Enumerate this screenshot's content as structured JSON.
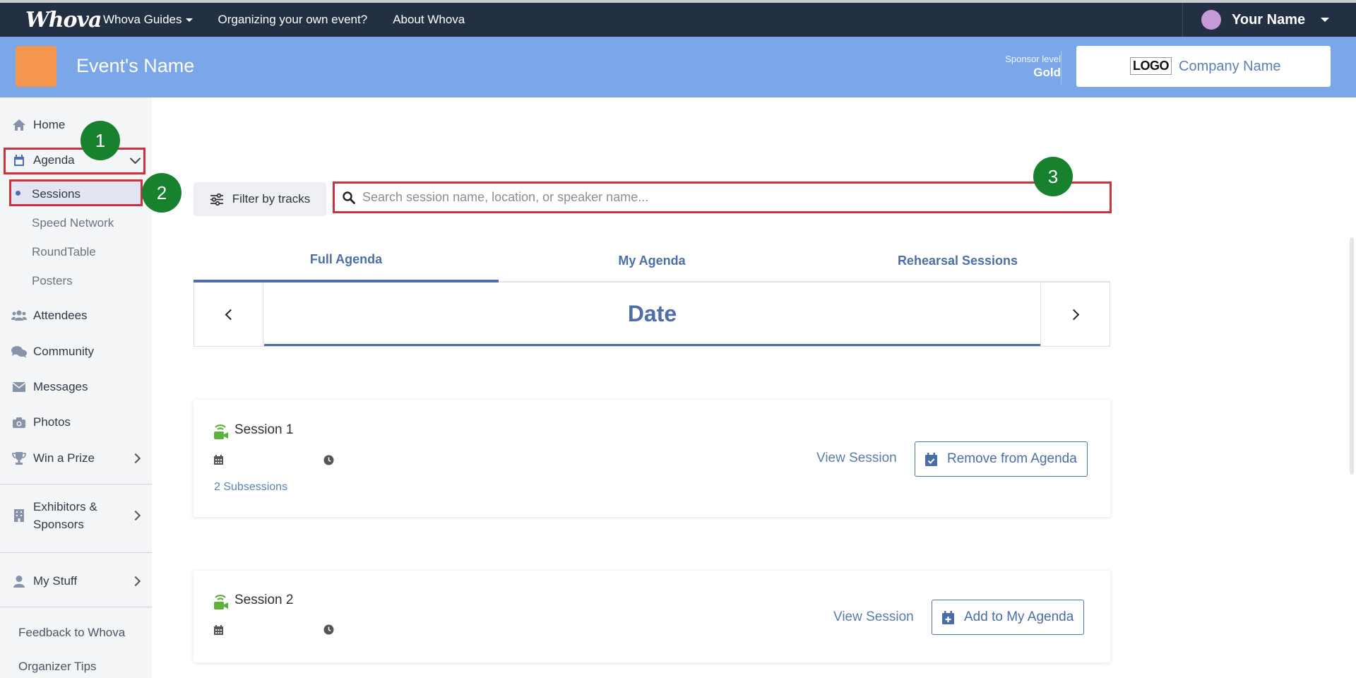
{
  "topnav": {
    "brand": "Whova",
    "links": [
      "Whova Guides",
      "Organizing your own event?",
      "About Whova"
    ],
    "user_name": "Your Name"
  },
  "banner": {
    "event_name": "Event's Name",
    "sponsor_level_label": "Sponsor level",
    "sponsor_level_value": "Gold",
    "logo_text": "LOGO",
    "company_name": "Company Name",
    "colors": {
      "banner": "#7ba7e8",
      "event_logo": "#f4964e",
      "topnav": "#233043"
    }
  },
  "sidebar": {
    "home": "Home",
    "agenda": "Agenda",
    "agenda_sub": [
      "Sessions",
      "Speed Network",
      "RoundTable",
      "Posters"
    ],
    "attendees": "Attendees",
    "community": "Community",
    "messages": "Messages",
    "photos": "Photos",
    "win_prize": "Win a Prize",
    "exhibitors_line1": "Exhibitors &",
    "exhibitors_line2": "Sponsors",
    "my_stuff": "My Stuff",
    "feedback": "Feedback to Whova",
    "organizer_tips": "Organizer Tips"
  },
  "annotations": {
    "badges": [
      "1",
      "2",
      "3"
    ],
    "highlight_color": "#d32f3b",
    "badge_color": "#17812e"
  },
  "main": {
    "filter_label": "Filter by tracks",
    "search_placeholder": "Search session name, location, or speaker name...",
    "tabs": [
      "Full Agenda",
      "My Agenda",
      "Rehearsal Sessions"
    ],
    "active_tab": "Full Agenda",
    "date_label": "Date",
    "sessions": [
      {
        "title": "Session 1",
        "subsessions": "2 Subsessions",
        "view_label": "View Session",
        "action_label": "Remove from Agenda"
      },
      {
        "title": "Session 2",
        "view_label": "View Session",
        "action_label": "Add to My Agenda"
      }
    ]
  }
}
